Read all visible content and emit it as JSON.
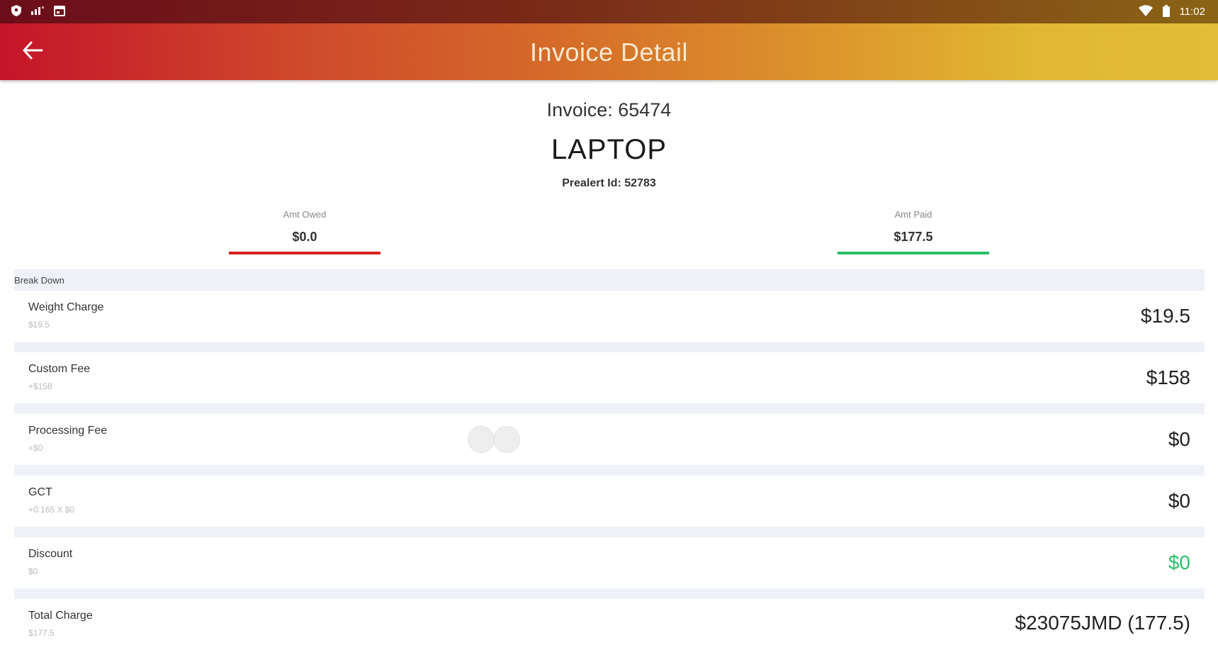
{
  "status_bar": {
    "time": "11:02",
    "icons": [
      "shield-icon",
      "signal-icon",
      "calendar-icon",
      "wifi-icon",
      "battery-icon"
    ]
  },
  "app_bar": {
    "title": "Invoice Detail",
    "back_icon": "arrow-left-icon"
  },
  "invoice": {
    "number_label": "Invoice: 65474",
    "item": "LAPTOP",
    "prealert": "Prealert Id: 52783"
  },
  "amounts": {
    "owed_label": "Amt Owed",
    "owed_value": "$0.0",
    "paid_label": "Amt Paid",
    "paid_value": "$177.5",
    "owed_color": "#d91f1f",
    "paid_color": "#2bbd6b"
  },
  "breakdown": {
    "header": "Break Down",
    "rows": [
      {
        "label": "Weight Charge",
        "sub": "$19.5",
        "value": "$19.5"
      },
      {
        "label": "Custom Fee",
        "sub": "+$158",
        "value": "$158"
      },
      {
        "label": "Processing Fee",
        "sub": "+$0",
        "value": "$0"
      },
      {
        "label": "GCT",
        "sub": "+0.165 X $0",
        "value": "$0"
      },
      {
        "label": "Discount",
        "sub": "$0",
        "value": "$0"
      },
      {
        "label": "Total Charge",
        "sub": "$177.5",
        "value": "$23075JMD (177.5)"
      }
    ]
  },
  "colors": {
    "accent_red": "#c4152a",
    "accent_gold": "#e2bd35",
    "discount_green": "#2bbd6b"
  }
}
